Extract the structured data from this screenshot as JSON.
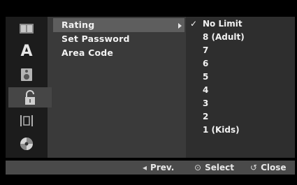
{
  "sidebar": {
    "icons": [
      {
        "name": "disc-info-icon",
        "selected": false
      },
      {
        "name": "language-icon",
        "label": "A",
        "selected": false
      },
      {
        "name": "audio-icon",
        "selected": false
      },
      {
        "name": "lock-icon",
        "selected": true
      },
      {
        "name": "film-icon",
        "selected": false
      },
      {
        "name": "disc-icon",
        "selected": false
      }
    ]
  },
  "menu": {
    "items": [
      {
        "label": "Rating",
        "selected": true
      },
      {
        "label": "Set Password",
        "selected": false
      },
      {
        "label": "Area Code",
        "selected": false
      }
    ]
  },
  "options": {
    "items": [
      {
        "label": "No Limit",
        "checked": true
      },
      {
        "label": "8 (Adult)",
        "checked": false
      },
      {
        "label": "7",
        "checked": false
      },
      {
        "label": "6",
        "checked": false
      },
      {
        "label": "5",
        "checked": false
      },
      {
        "label": "4",
        "checked": false
      },
      {
        "label": "3",
        "checked": false
      },
      {
        "label": "2",
        "checked": false
      },
      {
        "label": "1 (Kids)",
        "checked": false
      }
    ],
    "check_glyph": "✓"
  },
  "footer": {
    "prev_symbol": "◂",
    "prev_label": "Prev.",
    "select_symbol": "⊙",
    "select_label": "Select",
    "close_symbol": "↺",
    "close_label": "Close"
  },
  "colors": {
    "background": "#000000",
    "panel": "#3a3a3a",
    "selected": "#5e5e5e",
    "text": "#f2f2f2"
  }
}
